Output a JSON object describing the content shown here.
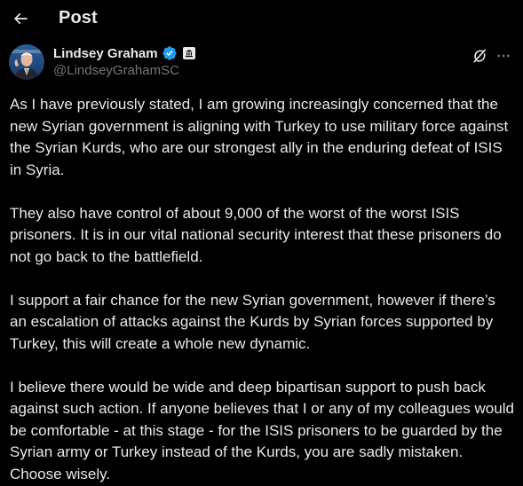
{
  "nav": {
    "title": "Post",
    "back_icon": "arrow-left-icon"
  },
  "author": {
    "name": "Lindsey Graham",
    "handle": "@LindseyGrahamSC",
    "verified_icon": "verified-badge-icon",
    "affiliation_icon": "government-affiliation-icon"
  },
  "actions": {
    "grok_icon": "grok-icon",
    "more_icon": "more-horizontal-icon"
  },
  "post": {
    "paragraphs": [
      "As I have previously stated, I am growing increasingly concerned that the new Syrian government is aligning with Turkey to use military force against the Syrian Kurds, who are our strongest ally in the enduring defeat of ISIS in Syria.",
      "They also have control of about 9,000 of the worst of the worst ISIS prisoners. It is in our vital national security interest that these prisoners do not go back to the battlefield.",
      "I support a fair chance for the new Syrian government, however if there’s an escalation of attacks against the Kurds by Syrian forces supported by Turkey, this will create a whole new dynamic.",
      "I believe there would be wide and deep bipartisan support to push back against such action. If anyone believes that I or any of my colleagues would be comfortable - at this stage - for the ISIS prisoners to be guarded by the Syrian army or Turkey instead of the Kurds, you are sadly mistaken. Choose wisely."
    ]
  },
  "colors": {
    "background": "#000000",
    "text": "#e7e9ea",
    "secondary_text": "#71767b",
    "verified_blue": "#1d9bf0"
  }
}
